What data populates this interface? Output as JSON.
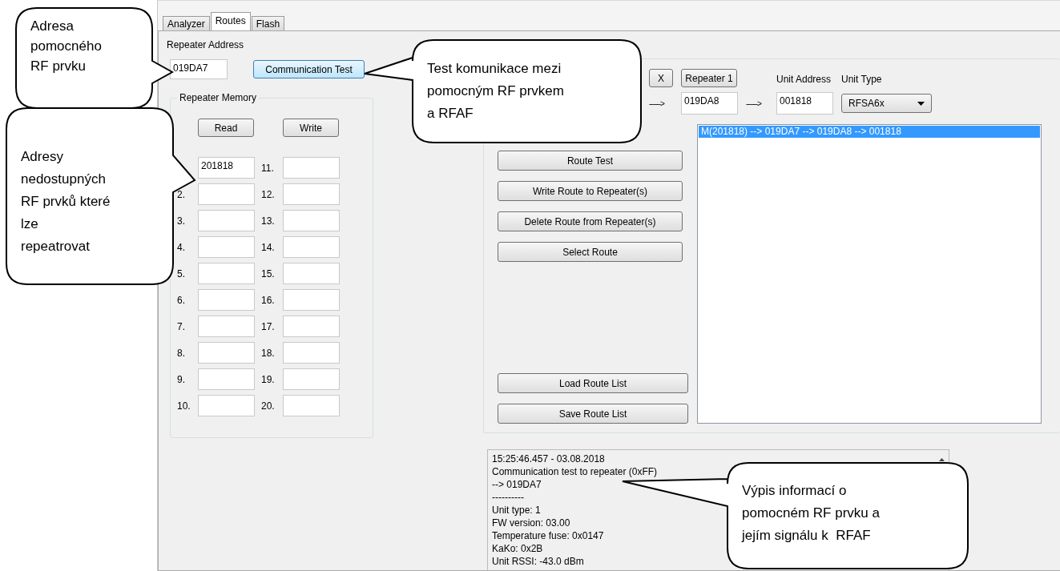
{
  "tabs": [
    {
      "label": "Analyzer",
      "selected": false
    },
    {
      "label": "Routes",
      "selected": true
    },
    {
      "label": "Flash",
      "selected": false
    }
  ],
  "repeater_address": {
    "label": "Repeater Address",
    "value": "019DA7"
  },
  "communication_test_button": "Communication Test",
  "repeater_memory": {
    "title": "Repeater Memory",
    "buttons": [
      "Read",
      "Write"
    ],
    "slots": [
      {
        "value": "201818"
      },
      {
        "label": "2."
      },
      {
        "label": "3."
      },
      {
        "label": "4."
      },
      {
        "label": "5."
      },
      {
        "label": "6."
      },
      {
        "label": "7."
      },
      {
        "label": "8."
      },
      {
        "label": "9."
      },
      {
        "label": "10."
      },
      {
        "label": "11."
      },
      {
        "label": "12."
      },
      {
        "label": "13."
      },
      {
        "label": "14."
      },
      {
        "label": "15."
      },
      {
        "label": "16."
      },
      {
        "label": "17."
      },
      {
        "label": "18."
      },
      {
        "label": "19."
      },
      {
        "label": "20."
      }
    ]
  },
  "route_builder": {
    "remove_button": "X",
    "repeater_button": "Repeater 1",
    "arrows": [
      "------>",
      "------>"
    ],
    "repeater_value": "019DA8",
    "unit_address": {
      "label": "Unit Address",
      "value": "001818"
    },
    "unit_type": {
      "label": "Unit Type",
      "value": "RFSA6x"
    }
  },
  "route_actions": [
    "Route Test",
    "Write Route to Repeater(s)",
    "Delete Route from Repeater(s)",
    "Select Route"
  ],
  "route_list_actions": [
    "Load Route List",
    "Save Route List"
  ],
  "route_list": [
    {
      "text": "M(201818) --> 019DA7 --> 019DA8 --> 001818",
      "selected": true
    }
  ],
  "log": [
    "15:25:46.457 - 03.08.2018",
    "Communication test to repeater (0xFF)",
    "--> 019DA7",
    "----------",
    "Unit type: 1",
    "FW version: 03.00",
    "Temperature fuse: 0x0147",
    "KaKo: 0x2B",
    "Unit RSSI: -43.0 dBm"
  ],
  "callouts": [
    {
      "text": "Adresa\npomocného\nRF prvku"
    },
    {
      "text": "Adresy\nnedostupných\nRF prvků které\nlze\nrepeatrovat"
    },
    {
      "text": "Test komunikace mezi\npomocným RF prvkem\na RFAF"
    },
    {
      "text": "Výpis informací o\npomocném RF prvku a\njejím signálu k  RFAF"
    }
  ]
}
